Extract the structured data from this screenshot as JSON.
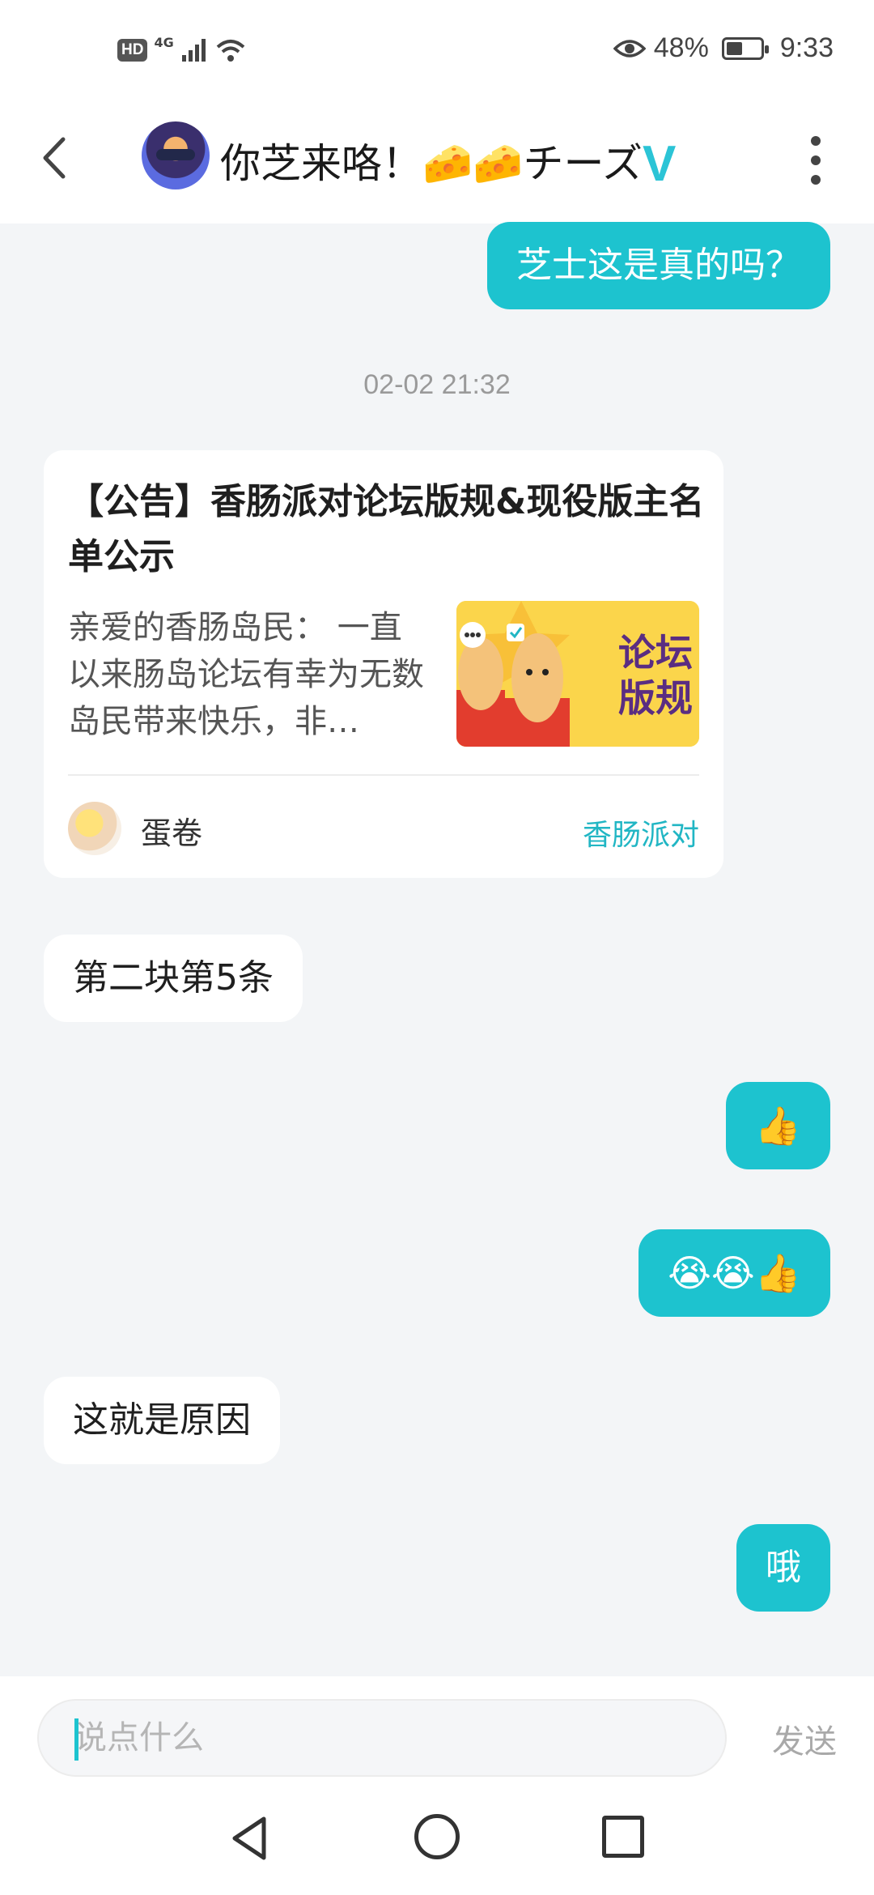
{
  "status_bar": {
    "left_badge": "HD",
    "network": "4G",
    "battery_percent": "48%",
    "battery_level": 0.48,
    "time": "9:33"
  },
  "header": {
    "title": "你芝来咯！🧀🧀チーズ",
    "verified_badge": "V"
  },
  "messages": {
    "msg1": "芝士这是真的吗？",
    "timestamp": "02-02 21:32",
    "card": {
      "title": "【公告】香肠派对论坛版规&现役版主名单公示",
      "excerpt": "亲爱的香肠岛民： 一直以来肠岛论坛有幸为无数岛民带来快乐，非…",
      "image_text": "论坛版规",
      "author": "蛋卷",
      "forum": "香肠派对"
    },
    "msg2": "第二块第5条",
    "msg3": "👍",
    "msg4": "😭😭👍",
    "msg5": "这就是原因",
    "msg6": "哦"
  },
  "input": {
    "placeholder": "说点什么",
    "send_label": "发送"
  },
  "colors": {
    "accent": "#1dc3cf",
    "background": "#f3f5f7"
  }
}
